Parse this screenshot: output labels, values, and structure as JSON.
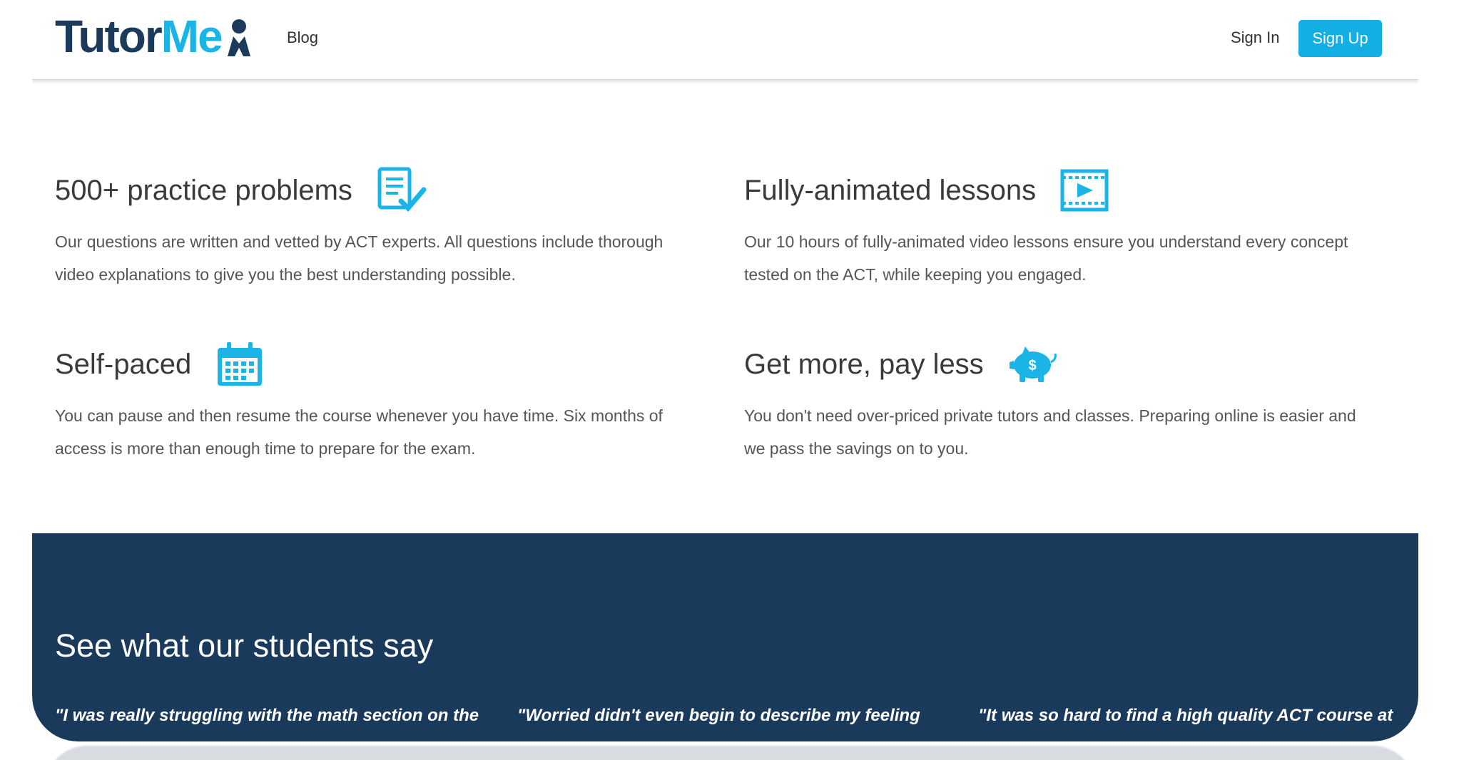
{
  "nav": {
    "logo_part1": "Tutor",
    "logo_part2": "Me",
    "blog": "Blog",
    "sign_in": "Sign In",
    "sign_up": "Sign Up"
  },
  "features": [
    {
      "title": "500+ practice problems",
      "icon": "checklist-icon",
      "description": "Our questions are written and vetted by ACT experts. All questions include thorough video explanations to give you the best understanding possible."
    },
    {
      "title": "Fully-animated lessons",
      "icon": "video-play-icon",
      "description": "Our 10 hours of fully-animated video lessons ensure you understand every concept tested on the ACT, while keeping you engaged."
    },
    {
      "title": "Self-paced",
      "icon": "calendar-icon",
      "description": "You can pause and then resume the course whenever you have time. Six months of access is more than enough time to prepare for the exam."
    },
    {
      "title": "Get more, pay less",
      "icon": "piggy-bank-icon",
      "description": "You don't need over-priced private tutors and classes. Preparing online is easier and we pass the savings on to you."
    }
  ],
  "testimonials": {
    "heading": "See what our students say",
    "quotes": [
      "\"I was really struggling with the math section on the",
      "\"Worried didn't even begin to describe my feeling",
      "\"It was so hard to find a high quality ACT course at"
    ]
  },
  "colors": {
    "brand_dark": "#1b3a5c",
    "brand_accent": "#1ab5e6",
    "testimonial_bg": "#1a3a5c"
  }
}
